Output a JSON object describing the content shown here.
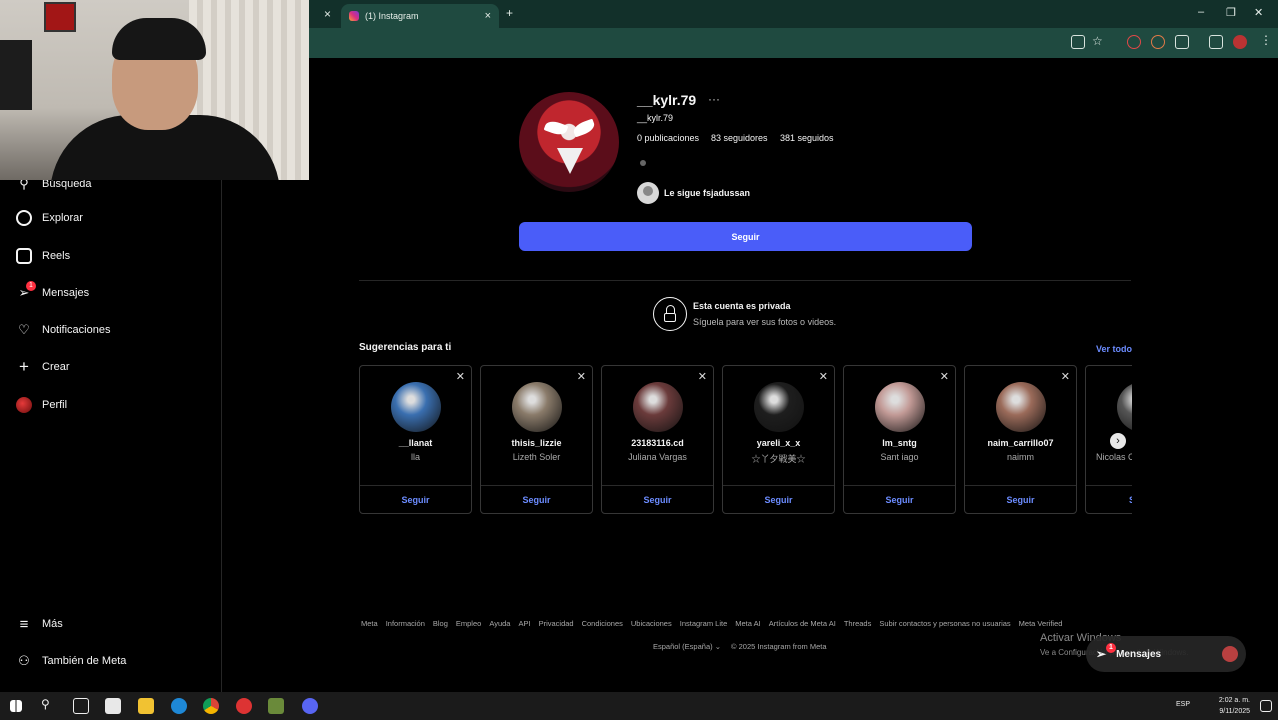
{
  "browser": {
    "tab_title": "(1) Instagram",
    "tab_close": "×",
    "new_tab": "+",
    "prev_tab_close": "×",
    "window_controls": [
      "–",
      "❐",
      "✕"
    ]
  },
  "sidebar": {
    "items": [
      {
        "label": "Búsqueda",
        "icon": "search-icon"
      },
      {
        "label": "Explorar",
        "icon": "compass-icon"
      },
      {
        "label": "Reels",
        "icon": "reels-icon"
      },
      {
        "label": "Mensajes",
        "icon": "messages-icon",
        "badge": "1"
      },
      {
        "label": "Notificaciones",
        "icon": "heart-icon"
      },
      {
        "label": "Crear",
        "icon": "plus-icon"
      },
      {
        "label": "Perfil",
        "icon": "profile-avatar-icon"
      }
    ],
    "bottom": [
      {
        "label": "Más",
        "icon": "menu-icon"
      },
      {
        "label": "También de Meta",
        "icon": "meta-icon"
      }
    ]
  },
  "profile": {
    "username": "__kylr.79",
    "more": "···",
    "handle": "__kylr.79",
    "posts": "0 publicaciones",
    "followers": "83 seguidores",
    "following": "381 seguidos",
    "followed_by": "Le sigue fsjadussan",
    "follow_button": "Seguir"
  },
  "private": {
    "title": "Esta cuenta es privada",
    "subtitle": "Síguela para ver sus fotos o videos."
  },
  "suggestions": {
    "title": "Sugerencias para ti",
    "see_all": "Ver todo",
    "cards": [
      {
        "username": "__llanat",
        "name": "lla",
        "follow": "Seguir",
        "color": "#3a6fb0"
      },
      {
        "username": "thisis_lizzie",
        "name": "Lizeth Soler",
        "follow": "Seguir",
        "color": "#8a7b6a"
      },
      {
        "username": "23183116.cd",
        "name": "Juliana Vargas",
        "follow": "Seguir",
        "color": "#6b3b3b"
      },
      {
        "username": "yareli_x_x",
        "name": "☆丫夕戦美☆",
        "follow": "Seguir",
        "color": "#1e1e1e"
      },
      {
        "username": "lm_sntg",
        "name": "Sant iago",
        "follow": "Seguir",
        "color": "#c29a96"
      },
      {
        "username": "naim_carrillo07",
        "name": "naimm",
        "follow": "Seguir",
        "color": "#9b6b5a"
      },
      {
        "username": "",
        "name": "Nicolas C",
        "follow": "S",
        "color": "#555555"
      }
    ],
    "next": "›"
  },
  "footer": {
    "links": [
      "Meta",
      "Información",
      "Blog",
      "Empleo",
      "Ayuda",
      "API",
      "Privacidad",
      "Condiciones",
      "Ubicaciones",
      "Instagram Lite",
      "Meta AI",
      "Artículos de Meta AI",
      "Threads",
      "Subir contactos y personas no usuarias",
      "Meta Verified"
    ],
    "language": "Español (España) ⌄",
    "copyright": "© 2025 Instagram from Meta"
  },
  "overlay": {
    "activate_title": "Activar Windows",
    "activate_sub": "Ve a Configuración para activar Windows.",
    "messages_pill": "Mensajes",
    "messages_badge": "1"
  },
  "taskbar": {
    "language": "ESP",
    "time": "2:02 a. m.",
    "date": "9/11/2025"
  }
}
